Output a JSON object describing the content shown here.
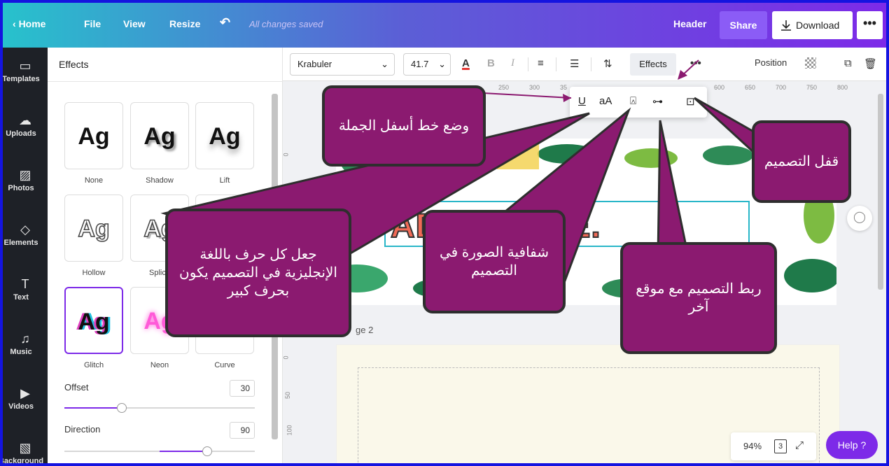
{
  "topbar": {
    "home": "Home",
    "file": "File",
    "view": "View",
    "resize": "Resize",
    "undo_icon": "undo-icon",
    "saved_status": "All changes saved",
    "header": "Header",
    "share": "Share",
    "download": "Download",
    "more": "•••"
  },
  "rail": [
    {
      "label": "Templates",
      "icon": "▭"
    },
    {
      "label": "Uploads",
      "icon": "☁"
    },
    {
      "label": "Photos",
      "icon": "▨"
    },
    {
      "label": "Elements",
      "icon": "◇"
    },
    {
      "label": "Text",
      "icon": "T"
    },
    {
      "label": "Music",
      "icon": "♫"
    },
    {
      "label": "Videos",
      "icon": "▶"
    },
    {
      "label": "Background",
      "icon": "▧"
    }
  ],
  "panel": {
    "title": "Effects",
    "effects": [
      {
        "label": "None",
        "sample": "Ag"
      },
      {
        "label": "Shadow",
        "sample": "Ag"
      },
      {
        "label": "Lift",
        "sample": "Ag"
      },
      {
        "label": "Hollow",
        "sample": "Ag"
      },
      {
        "label": "Splice",
        "sample": "Ag"
      },
      {
        "label": "Glitch",
        "sample": "Ag"
      },
      {
        "label": "Neon",
        "sample": "Ag"
      },
      {
        "label": "Curve",
        "sample": ""
      }
    ],
    "offset": {
      "label": "Offset",
      "value": "30",
      "level": 0.3
    },
    "direction": {
      "label": "Direction",
      "value": "90",
      "level": 0.75
    }
  },
  "toolbar": {
    "font": "Krabuler",
    "size": "41.7",
    "color_letter": "A",
    "bold": "B",
    "italic": "I",
    "effects": "Effects",
    "more": "•••",
    "position": "Position"
  },
  "ruler": {
    "top": [
      "250",
      "300",
      "35",
      "600",
      "650",
      "700",
      "750",
      "800"
    ],
    "left": [
      "0",
      "50",
      "0",
      "50",
      "100"
    ]
  },
  "canvas": {
    "title_text": "ADVE   TURE.",
    "page2_label": "ge 2"
  },
  "mini_toolbar": {
    "underline": "U",
    "case": "aA"
  },
  "bottom": {
    "zoom": "94%",
    "page_count": "3",
    "help": "Help ?"
  },
  "callouts": {
    "underline": "وضع خط أسفل الجملة",
    "lock": "قفل التصميم",
    "uppercase": "جعل كل حرف باللغة الإنجليزية في التصميم يكون بحرف كبير",
    "transparency": "شفافية الصورة في التصميم",
    "link": "ربط التصميم مع موقع آخر"
  },
  "colors": {
    "accent": "#7d2ae8",
    "callout_fill": "#8b1a70",
    "callout_border": "#2e2e2e",
    "frame": "#1414e0",
    "title_fill": "#f06a56"
  }
}
